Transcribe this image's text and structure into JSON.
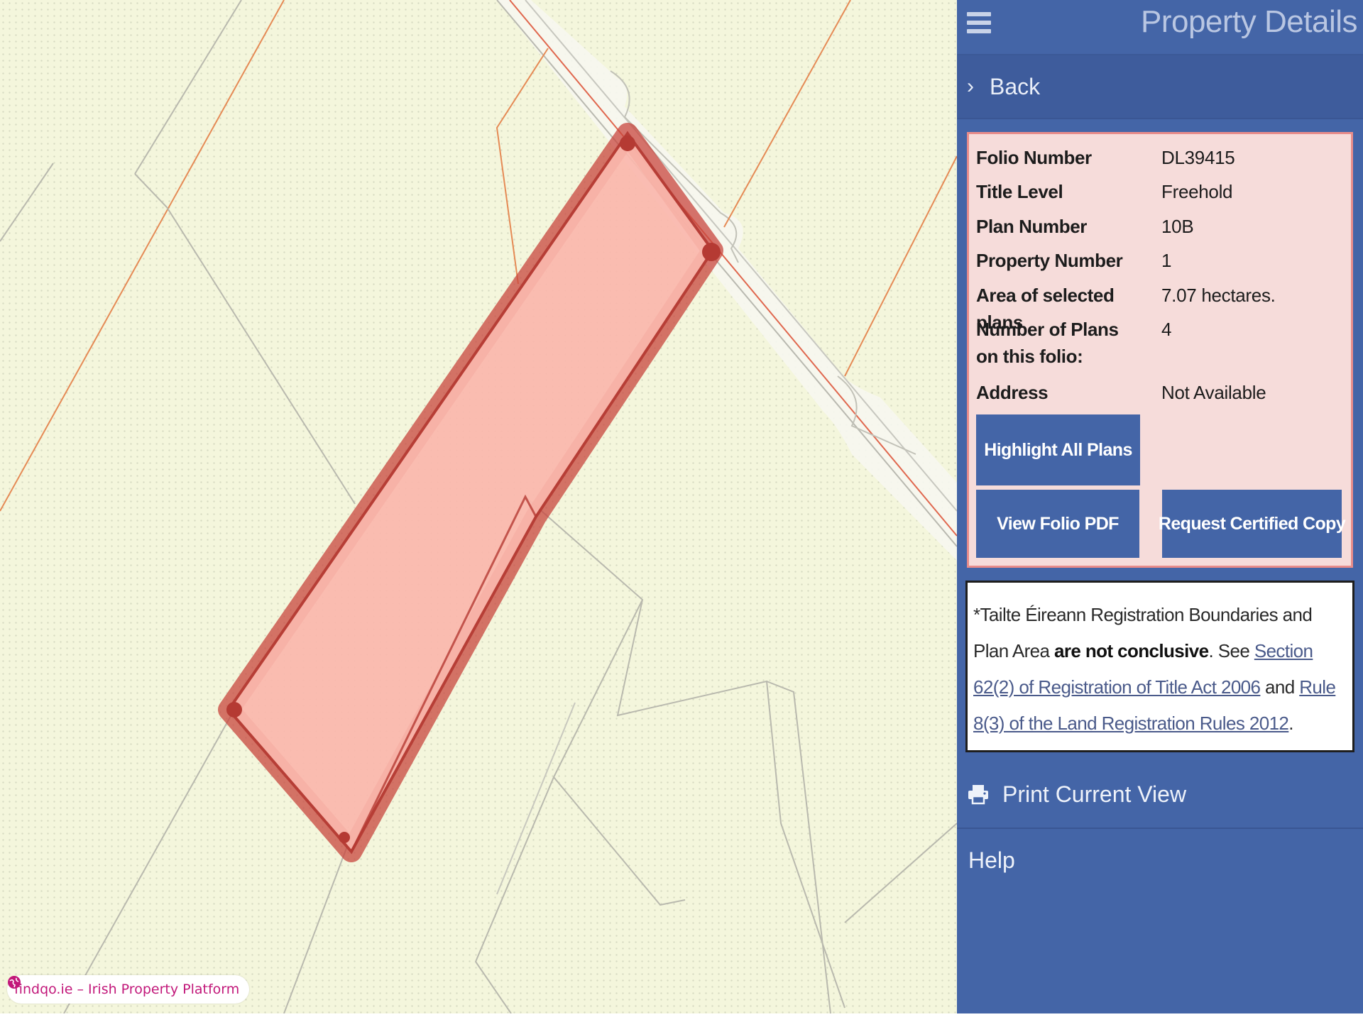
{
  "panel": {
    "title": "Property Details",
    "back_label": "Back",
    "details": [
      {
        "key": "Folio Number",
        "value": "DL39415"
      },
      {
        "key": "Title Level",
        "value": "Freehold"
      },
      {
        "key": "Plan Number",
        "value": "10B"
      },
      {
        "key": "Property Number",
        "value": "1"
      },
      {
        "key": "Area of selected plans",
        "value": "7.07 hectares."
      },
      {
        "key": "Number of Plans on this folio:",
        "value": "4"
      },
      {
        "key": "Address",
        "value": "Not Available"
      }
    ],
    "buttons": {
      "highlight": "Highlight All Plans",
      "view_pdf": "View Folio PDF",
      "certified": "Request Certified Copy"
    },
    "notice": {
      "prefix": "*Tailte Éireann Registration Boundaries and Plan Area ",
      "bold": "are not conclusive",
      "see": ". See ",
      "link1": "Section 62(2) of Registration of Title Act 2006",
      "and": " and ",
      "link2": "Rule 8(3) of the Land Registration Rules 2012",
      "end": "."
    },
    "print_label": "Print Current View",
    "help_label": "Help"
  },
  "watermark": "findqo.ie – Irish Property Platform",
  "colors": {
    "panel_bg": "#4465a7",
    "details_bg": "#f6dcda",
    "parcel_fill": "#fbb8ad",
    "parcel_stroke": "#c8463d",
    "map_bg": "#f4f6dc"
  },
  "icons": {
    "menu": "hamburger-icon",
    "back": "chevron-right-icon",
    "print": "printer-icon",
    "watermark": "globe-icon"
  }
}
